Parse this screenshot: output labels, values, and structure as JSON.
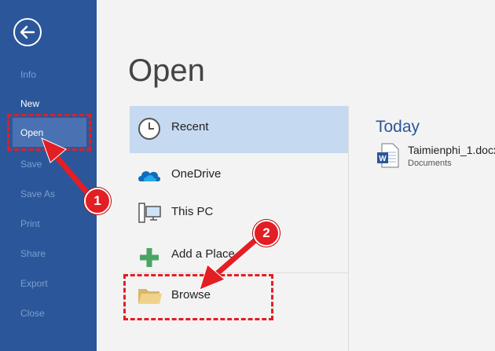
{
  "sidebar": {
    "items": [
      {
        "label": "Info"
      },
      {
        "label": "New"
      },
      {
        "label": "Open"
      },
      {
        "label": "Save"
      },
      {
        "label": "Save As"
      },
      {
        "label": "Print"
      },
      {
        "label": "Share"
      },
      {
        "label": "Export"
      },
      {
        "label": "Close"
      }
    ]
  },
  "main": {
    "title": "Open",
    "locations": [
      {
        "label": "Recent",
        "icon": "clock-icon"
      },
      {
        "label": "OneDrive",
        "icon": "cloud-icon"
      },
      {
        "label": "This PC",
        "icon": "computer-icon"
      },
      {
        "label": "Add a Place",
        "icon": "plus-icon"
      },
      {
        "label": "Browse",
        "icon": "folder-icon"
      }
    ]
  },
  "recent": {
    "group": "Today",
    "files": [
      {
        "name": "Taimienphi_1.docx",
        "location": "Documents",
        "icon": "word-doc-icon"
      }
    ]
  },
  "annotations": {
    "step1": "1",
    "step2": "2"
  },
  "colors": {
    "sidebar": "#2b579a",
    "selected": "#c5d9f1",
    "annotation": "#e31e24",
    "accent": "#2b579a"
  }
}
